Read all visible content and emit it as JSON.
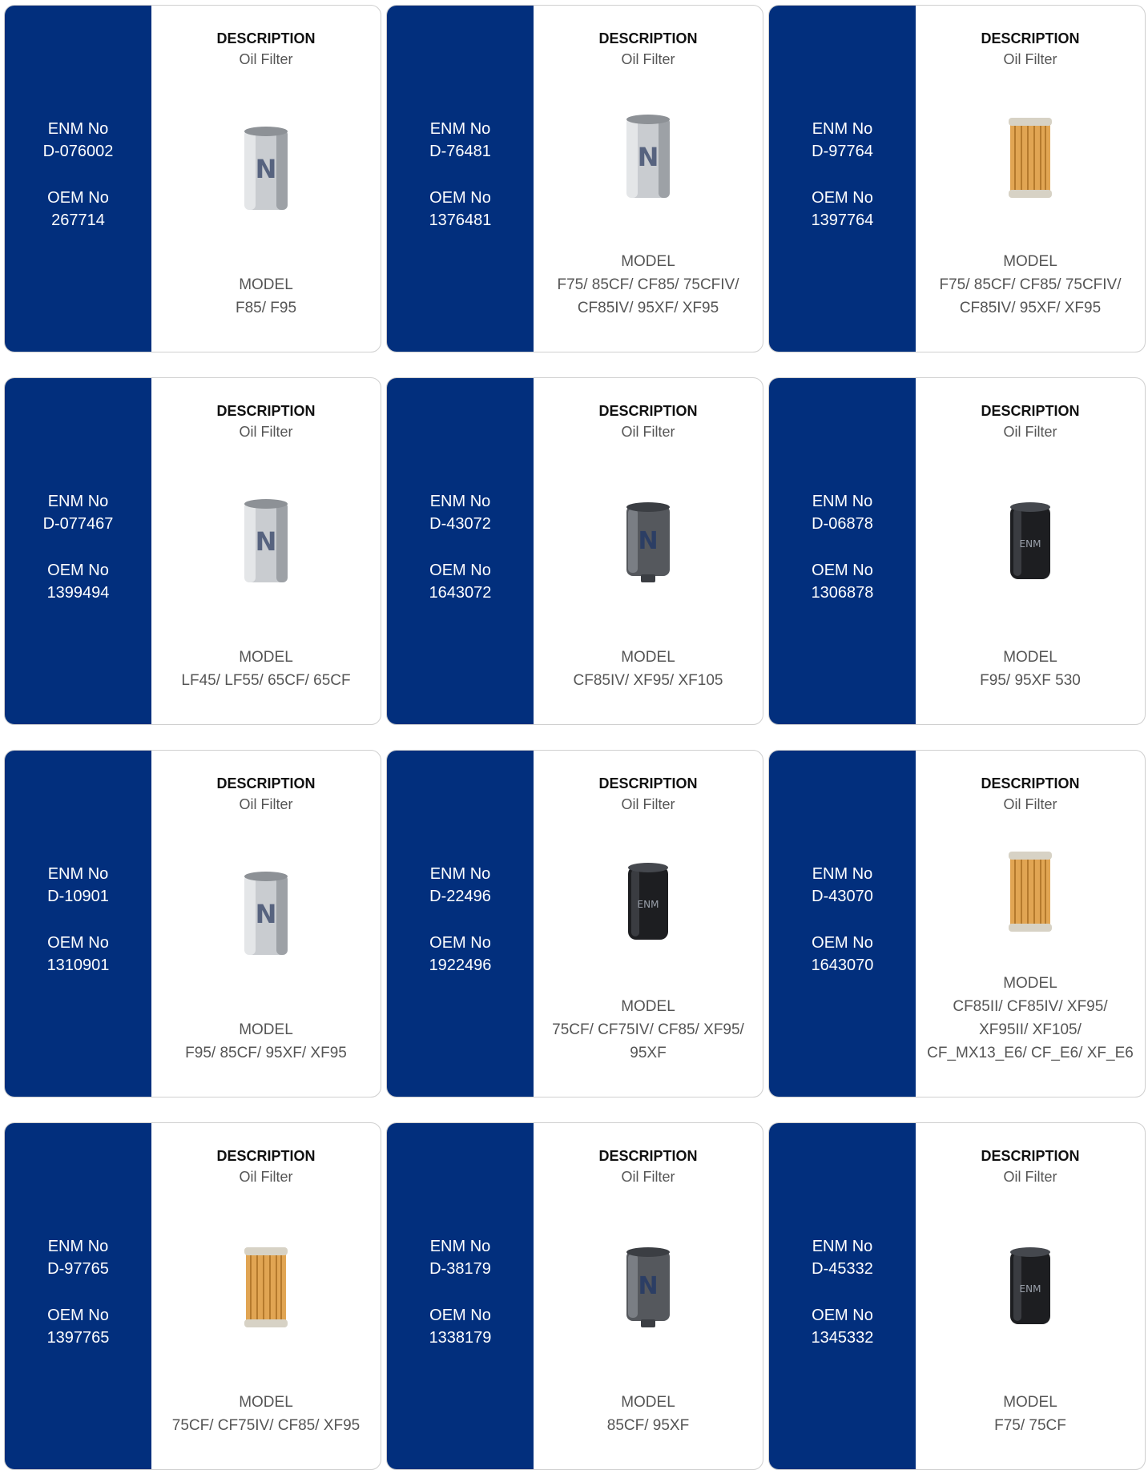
{
  "labels": {
    "enm": "ENM No",
    "oem": "OEM No",
    "description": "DESCRIPTION",
    "model": "MODEL"
  },
  "products": [
    {
      "enm_no": "D-076002",
      "oem_no": "267714",
      "description": "Oil Filter",
      "model": [
        "F85/ F95"
      ],
      "image": "silver-oil-filter-icon"
    },
    {
      "enm_no": "D-76481",
      "oem_no": "1376481",
      "description": "Oil Filter",
      "model": [
        "F75/ 85CF/ CF85/ 75CFIV/",
        "CF85IV/ 95XF/ XF95"
      ],
      "image": "silver-oil-filter-icon"
    },
    {
      "enm_no": "D-97764",
      "oem_no": "1397764",
      "description": "Oil Filter",
      "model": [
        "F75/ 85CF/ CF85/ 75CFIV/",
        "CF85IV/ 95XF/ XF95"
      ],
      "image": "cartridge-oil-filter-icon"
    },
    {
      "enm_no": "D-077467",
      "oem_no": "1399494",
      "description": "Oil Filter",
      "model": [
        "LF45/ LF55/ 65CF/ 65CF"
      ],
      "image": "silver-oil-filter-icon"
    },
    {
      "enm_no": "D-43072",
      "oem_no": "1643072",
      "description": "Oil Filter",
      "model": [
        "CF85IV/ XF95/ XF105"
      ],
      "image": "dark-oil-filter-icon"
    },
    {
      "enm_no": "D-06878",
      "oem_no": "1306878",
      "description": "Oil Filter",
      "model": [
        "F95/ 95XF 530"
      ],
      "image": "black-oil-filter-icon"
    },
    {
      "enm_no": "D-10901",
      "oem_no": "1310901",
      "description": "Oil Filter",
      "model": [
        "F95/ 85CF/ 95XF/ XF95"
      ],
      "image": "silver-oil-filter-icon"
    },
    {
      "enm_no": "D-22496",
      "oem_no": "1922496",
      "description": "Oil Filter",
      "model": [
        "75CF/ CF75IV/ CF85/ XF95/",
        "95XF"
      ],
      "image": "black-oil-filter-icon"
    },
    {
      "enm_no": "D-43070",
      "oem_no": "1643070",
      "description": "Oil Filter",
      "model": [
        "CF85II/ CF85IV/ XF95/",
        "XF95II/ XF105/",
        "CF_MX13_E6/ CF_E6/ XF_E6"
      ],
      "image": "cartridge-oil-filter-icon"
    },
    {
      "enm_no": "D-97765",
      "oem_no": "1397765",
      "description": "Oil Filter",
      "model": [
        "75CF/ CF75IV/ CF85/ XF95"
      ],
      "image": "cartridge-oil-filter-icon"
    },
    {
      "enm_no": "D-38179",
      "oem_no": "1338179",
      "description": "Oil Filter",
      "model": [
        "85CF/ 95XF"
      ],
      "image": "dark-oil-filter-icon"
    },
    {
      "enm_no": "D-45332",
      "oem_no": "1345332",
      "description": "Oil Filter",
      "model": [
        "F75/ 75CF"
      ],
      "image": "black-oil-filter-icon"
    }
  ],
  "colors": {
    "panel": "#022f7d",
    "border": "#cfcfcf",
    "heading": "#111111",
    "text": "#555555"
  }
}
